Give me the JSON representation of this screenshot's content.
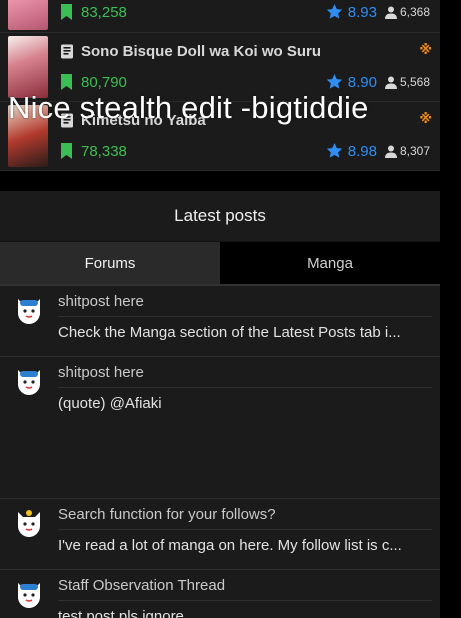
{
  "manga": [
    {
      "title": "",
      "follows": "83,258",
      "rating": "8.93",
      "views": "6,368",
      "hot": false
    },
    {
      "title": "Sono Bisque Doll wa Koi wo Suru",
      "follows": "80,790",
      "rating": "8.90",
      "views": "5,568",
      "hot": true,
      "hot_mark": "※"
    },
    {
      "title": "Kimetsu no Yaiba",
      "follows": "78,338",
      "rating": "8.98",
      "views": "8,307",
      "hot": true,
      "hot_mark": "※"
    }
  ],
  "overlay": {
    "text": "Nice stealth edit -bigtiddie"
  },
  "latest": {
    "header": "Latest posts",
    "tabs": [
      {
        "label": "Forums",
        "active": true
      },
      {
        "label": "Manga",
        "active": false
      }
    ],
    "posts": [
      {
        "title": "shitpost here",
        "body": "Check the Manga section of the Latest Posts tab i..."
      },
      {
        "title": "shitpost here",
        "body": "(quote) @Afiaki"
      },
      {
        "title": "Search function for your follows?",
        "body": "I've read a lot of manga on here. My follow list is c..."
      },
      {
        "title": "Staff Observation Thread",
        "body": "test post pls ignore"
      }
    ]
  },
  "colors": {
    "follows": "#3bbf54",
    "rating": "#2f8df3",
    "hot": "#f08c19",
    "panel": "#1b1b1b"
  }
}
